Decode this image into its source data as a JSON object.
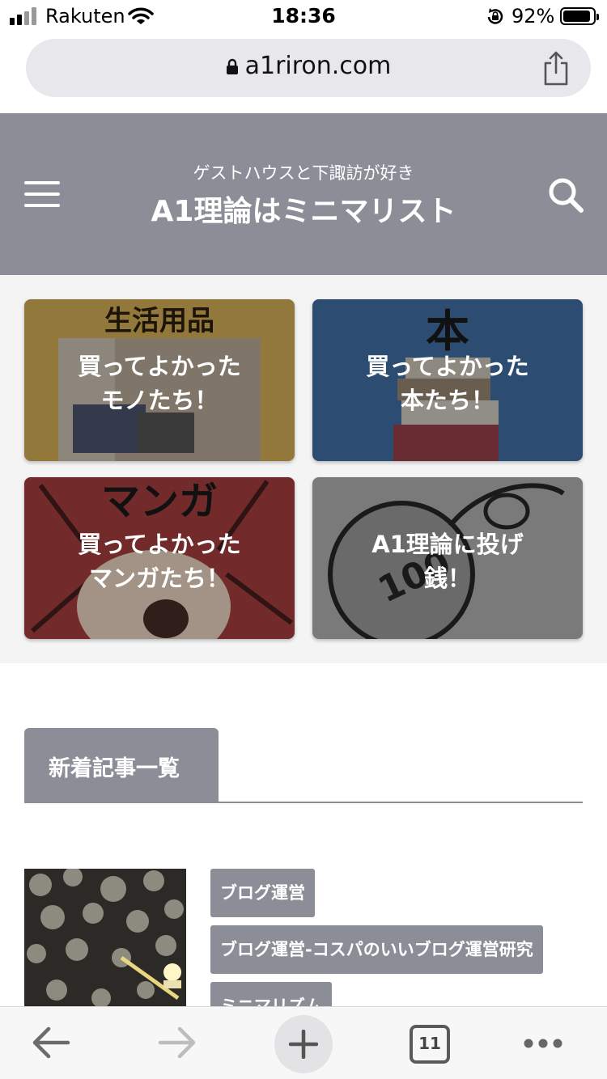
{
  "status": {
    "carrier": "Rakuten",
    "time": "18:36",
    "battery": "92%",
    "battery_level": 0.92
  },
  "browser": {
    "url": "a1riron.com",
    "tab_count": "11",
    "icons": [
      "lock-icon",
      "share-icon",
      "back-icon",
      "forward-icon",
      "new-tab-icon",
      "tabs-icon",
      "more-icon"
    ]
  },
  "header": {
    "tagline": "ゲストハウスと下諏訪が好き",
    "site_name": "A1理論はミニマリスト",
    "icons": [
      "hamburger-menu-icon",
      "search-icon"
    ]
  },
  "cards": [
    {
      "image_text": "生活用品",
      "line1": "買ってよかった",
      "line2": "モノたち！"
    },
    {
      "image_text": "本",
      "line1": "買ってよかった",
      "line2": "本たち！"
    },
    {
      "image_text": "マンガ",
      "line1": "買ってよかった",
      "line2": "マンガたち！"
    },
    {
      "image_text": "100",
      "line1": "A1理論に投げ",
      "line2": "銭！"
    }
  ],
  "section": {
    "title": "新着記事一覧"
  },
  "article": {
    "tags": [
      "ブログ運営",
      "ブログ運営-コスパのいいブログ運営研究",
      "ミニマリズム"
    ]
  },
  "colors": {
    "header_bg": "#8b8e97",
    "tag_bg": "#8b8e97",
    "cards_bg": "#f4f4f4"
  }
}
